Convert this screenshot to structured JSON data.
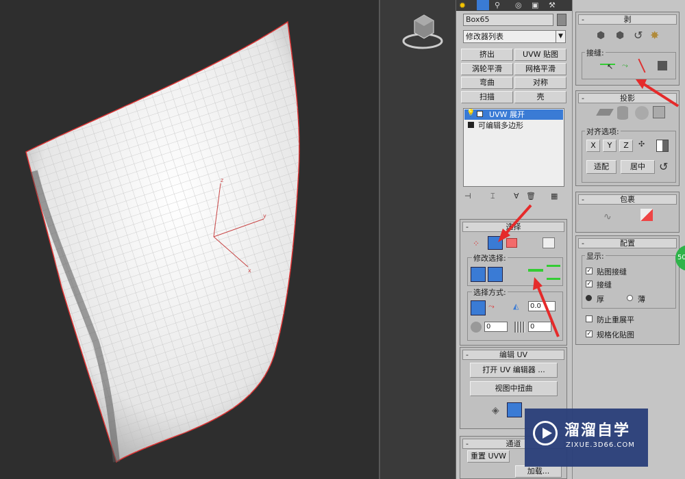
{
  "object_name": "Box65",
  "modifier_list_label": "修改器列表",
  "modifier_buttons": [
    "挤出",
    "UVW 贴图",
    "涡轮平滑",
    "网格平滑",
    "弯曲",
    "对称",
    "扫描",
    "壳"
  ],
  "stack_items": [
    "UVW 展开",
    "可编辑多边形"
  ],
  "selection_rollout": {
    "title": "选择",
    "modify_label": "修改选择:",
    "method_label": "选择方式:",
    "spin1": "0.0",
    "spin2": "0",
    "spin3": "0"
  },
  "edit_uv_rollout": {
    "title": "编辑 UV",
    "open_editor": "打开 UV 编辑器 ...",
    "view_distort": "视图中扭曲"
  },
  "channel_rollout": {
    "title": "通道",
    "reset_uvw": "重置 UVW",
    "load": "加载..."
  },
  "peel_rollout": {
    "title": "剥",
    "seams_label": "接缝:"
  },
  "projection_rollout": {
    "title": "投影",
    "align_label": "对齐选项:",
    "axis_buttons": [
      "X",
      "Y",
      "Z"
    ],
    "fit": "适配",
    "center": "居中"
  },
  "wrap_rollout": {
    "title": "包裹"
  },
  "config_rollout": {
    "title": "配置",
    "display_label": "显示:",
    "map_seams": "贴图接缝",
    "peel_seams": "接缝",
    "thick": "厚",
    "thin": "薄",
    "prevent_reflatten": "防止重展平",
    "normalize_map": "规格化贴图"
  },
  "badge": "50",
  "watermark": {
    "brand": "溜溜自学",
    "url": "ZIXUE.3D66.COM"
  },
  "gizmo": {
    "z": "z",
    "y": "y",
    "x": "x"
  },
  "colors": {
    "accent_blue": "#3a7bd5",
    "arrow_red": "#e52a2a",
    "panel": "#c0c0c0",
    "badge_green": "#2fb34a",
    "watermark_bg": "#2a3f7a"
  }
}
